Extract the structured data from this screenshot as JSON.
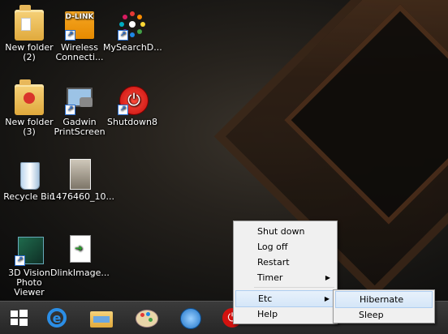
{
  "desktop": {
    "icons": [
      {
        "label": "New folder\n(2)",
        "kind": "folder"
      },
      {
        "label": "Wireless Connecti...",
        "kind": "dlink"
      },
      {
        "label": "MySearchD...",
        "kind": "dots"
      },
      {
        "label": "New folder\n(3)",
        "kind": "folder-music"
      },
      {
        "label": "Gadwin PrintScreen",
        "kind": "monitor"
      },
      {
        "label": "Shutdown8",
        "kind": "power"
      },
      {
        "label": "Recycle Bin",
        "kind": "recycle"
      },
      {
        "label": "1476460_10...",
        "kind": "photo"
      },
      {
        "label": "3D Vision Photo Viewer",
        "kind": "3d"
      },
      {
        "label": "DlinkImage...",
        "kind": "document"
      }
    ],
    "dlink_logo": "D-LINK"
  },
  "context_menu": {
    "items": [
      {
        "label": "Shut down",
        "submenu": false,
        "highlighted": false
      },
      {
        "label": "Log off",
        "submenu": false,
        "highlighted": false
      },
      {
        "label": "Restart",
        "submenu": false,
        "highlighted": false
      },
      {
        "label": "Timer",
        "submenu": true,
        "highlighted": false
      },
      {
        "label": "Etc",
        "submenu": true,
        "highlighted": true
      },
      {
        "label": "Help",
        "submenu": false,
        "highlighted": false
      }
    ],
    "submenu_glyph": "▶"
  },
  "submenu": {
    "items": [
      {
        "label": "Hibernate",
        "highlighted": true
      },
      {
        "label": "Sleep",
        "highlighted": false
      }
    ]
  },
  "taskbar": {
    "items": [
      "start-icon",
      "internet-explorer-icon",
      "file-explorer-icon",
      "paint-icon",
      "media-icon",
      "shutdown8-icon"
    ]
  },
  "colors": {
    "highlight": "#d5e6f8",
    "menu_bg": "#f0f0f0"
  }
}
